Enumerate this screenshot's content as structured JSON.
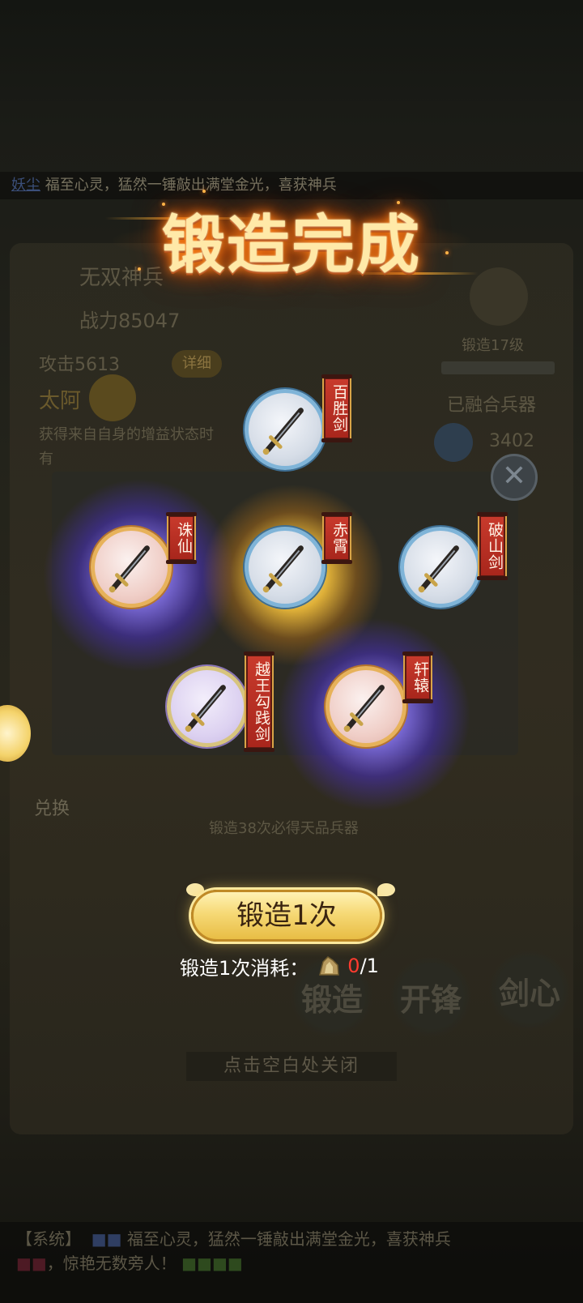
{
  "background": {
    "ticker": {
      "name": "妖尘",
      "message": "福至心灵，猛然一锤敲出满堂金光，喜获神兵"
    },
    "weapon_name": "无双神兵",
    "power_label": "战力85047",
    "attack_label": "攻击5613",
    "detail_button": "详细",
    "weapon_title": "太阿",
    "desc_line1": "获得来自自身的增益状态时",
    "desc_line2": "有",
    "forge_level": "锻造17级",
    "fused_label": "已融合兵器",
    "fused_value": "3402",
    "exchange_label": "兑换",
    "guarantee_hint": "锻造38次必得天品兵器",
    "tab_forge": "锻造",
    "tab_sharpen": "开锋",
    "tab_heart": "剑心",
    "chat_system": "【系统】",
    "chat_msg1": "福至心灵，猛然一锤敲出满堂金光，喜获神兵",
    "chat_msg2": "，惊艳无数旁人！"
  },
  "popup": {
    "title": "锻造完成",
    "rewards": [
      {
        "name": "百胜剑",
        "rarity": "blue",
        "glow": "none",
        "icon": "sword-icon"
      },
      {
        "name": "诛仙",
        "rarity": "orange",
        "glow": "purple",
        "icon": "sword-icon"
      },
      {
        "name": "赤霄",
        "rarity": "blue",
        "glow": "gold",
        "icon": "sword-icon"
      },
      {
        "name": "破山剑",
        "rarity": "blue",
        "glow": "none",
        "icon": "sword-icon"
      },
      {
        "name": "越王勾践剑",
        "rarity": "purple",
        "glow": "none",
        "icon": "sword-icon"
      },
      {
        "name": "轩辕",
        "rarity": "orange",
        "glow": "purple",
        "icon": "sword-icon"
      }
    ],
    "forge_button": "锻造1次",
    "cost_label": "锻造1次消耗：",
    "cost_have": "0",
    "cost_need": "/1",
    "close_hint": "点击空白处关闭"
  },
  "colors": {
    "tag_red": "#c83a2c",
    "button_gold": "#f6d976",
    "cost_insufficient": "#ff3b2f",
    "title_glow": "#ff8a1c"
  }
}
